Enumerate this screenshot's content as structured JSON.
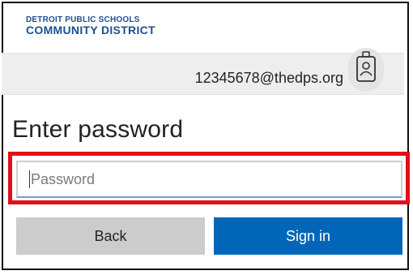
{
  "brand": {
    "line1": "DETROIT PUBLIC SCHOOLS",
    "line2": "COMMUNITY DISTRICT"
  },
  "identity": {
    "email": "12345678@thedps.org",
    "icon": "id-badge-icon"
  },
  "page": {
    "title": "Enter password"
  },
  "password_field": {
    "placeholder": "Password",
    "value": ""
  },
  "buttons": {
    "back_label": "Back",
    "signin_label": "Sign in"
  },
  "colors": {
    "brand_text": "#1f4f8f",
    "highlight_border": "#e0101a",
    "signin_bg": "#0067b8",
    "back_bg": "#cccccc"
  }
}
